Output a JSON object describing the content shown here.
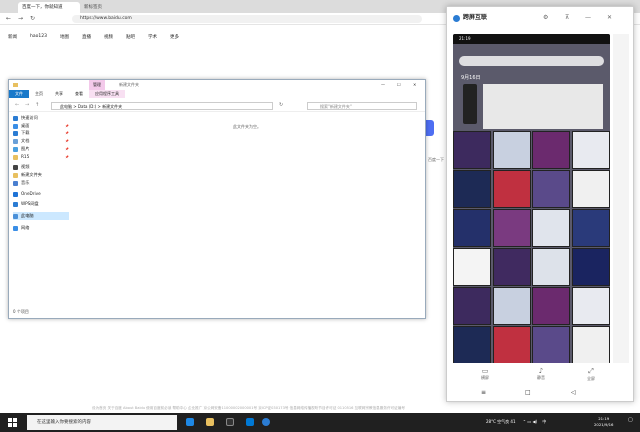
{
  "browser": {
    "tabs": [
      {
        "label": "百度一下，你就知道"
      },
      {
        "label": "新标签页"
      }
    ],
    "url": "https://www.baidu.com",
    "nav": [
      "新闻",
      "hao123",
      "地图",
      "直播",
      "视频",
      "贴吧",
      "学术",
      "更多"
    ]
  },
  "explorer": {
    "context_tab": "管理",
    "title": "新建文件夹",
    "ribbon": [
      "文件",
      "主页",
      "共享",
      "查看",
      "应用程序工具"
    ],
    "address": [
      "此电脑",
      "Data (D:)",
      "新建文件夹"
    ],
    "search_placeholder": "搜索\"新建文件夹\"",
    "empty_text": "此文件夹为空。",
    "sidebar": [
      {
        "label": "快速访问",
        "icon": "star-icon",
        "color": "#2b7cd3"
      },
      {
        "label": "桌面",
        "icon": "desktop-icon",
        "color": "#3a8ee6",
        "pinned": true
      },
      {
        "label": "下载",
        "icon": "download-icon",
        "color": "#2b7cd3",
        "pinned": true
      },
      {
        "label": "文档",
        "icon": "document-icon",
        "color": "#6aa0d8",
        "pinned": true
      },
      {
        "label": "图片",
        "icon": "picture-icon",
        "color": "#4aa0e0",
        "pinned": true
      },
      {
        "label": "R15",
        "icon": "folder-icon",
        "color": "#e8c060",
        "pinned": true
      },
      {
        "label": "视频",
        "icon": "video-icon",
        "color": "#444"
      },
      {
        "label": "新建文件夹",
        "icon": "folder-icon",
        "color": "#e8c060"
      },
      {
        "label": "音乐",
        "icon": "music-icon",
        "color": "#4a7fd0"
      },
      {
        "label": "OneDrive",
        "icon": "cloud-icon",
        "color": "#1e73d6"
      },
      {
        "label": "WPS网盘",
        "icon": "cloud-icon",
        "color": "#2b7cd3"
      },
      {
        "label": "此电脑",
        "icon": "computer-icon",
        "color": "#4a90d9",
        "selected": true
      },
      {
        "label": "网络",
        "icon": "network-icon",
        "color": "#3a8ee6"
      }
    ],
    "status": "0 个项目"
  },
  "baidu": {
    "side_text": "百度一下"
  },
  "phone": {
    "app_title": "跨屏互联",
    "time": "21:19",
    "date": "9月16日",
    "bottom_buttons": [
      "横屏",
      "静音",
      "全屏"
    ]
  },
  "footer": "设为首页  关于百度  About Baidu  使用百度前必读  帮助中心  企业推广  京公网安备11000002000001号  京ICP证030173号  信息网络传播视听节目许可证 0110516  互联网宗教信息服务许可证编号",
  "taskbar": {
    "search_placeholder": "在这里输入你要搜索的内容",
    "weather": "28°C 空气良 41",
    "lang": "中",
    "time": "21:19",
    "date": "2021/9/16"
  },
  "colors": {
    "accent": "#4e6ef2",
    "taskbar": "#202020",
    "selected": "#cce8ff"
  }
}
